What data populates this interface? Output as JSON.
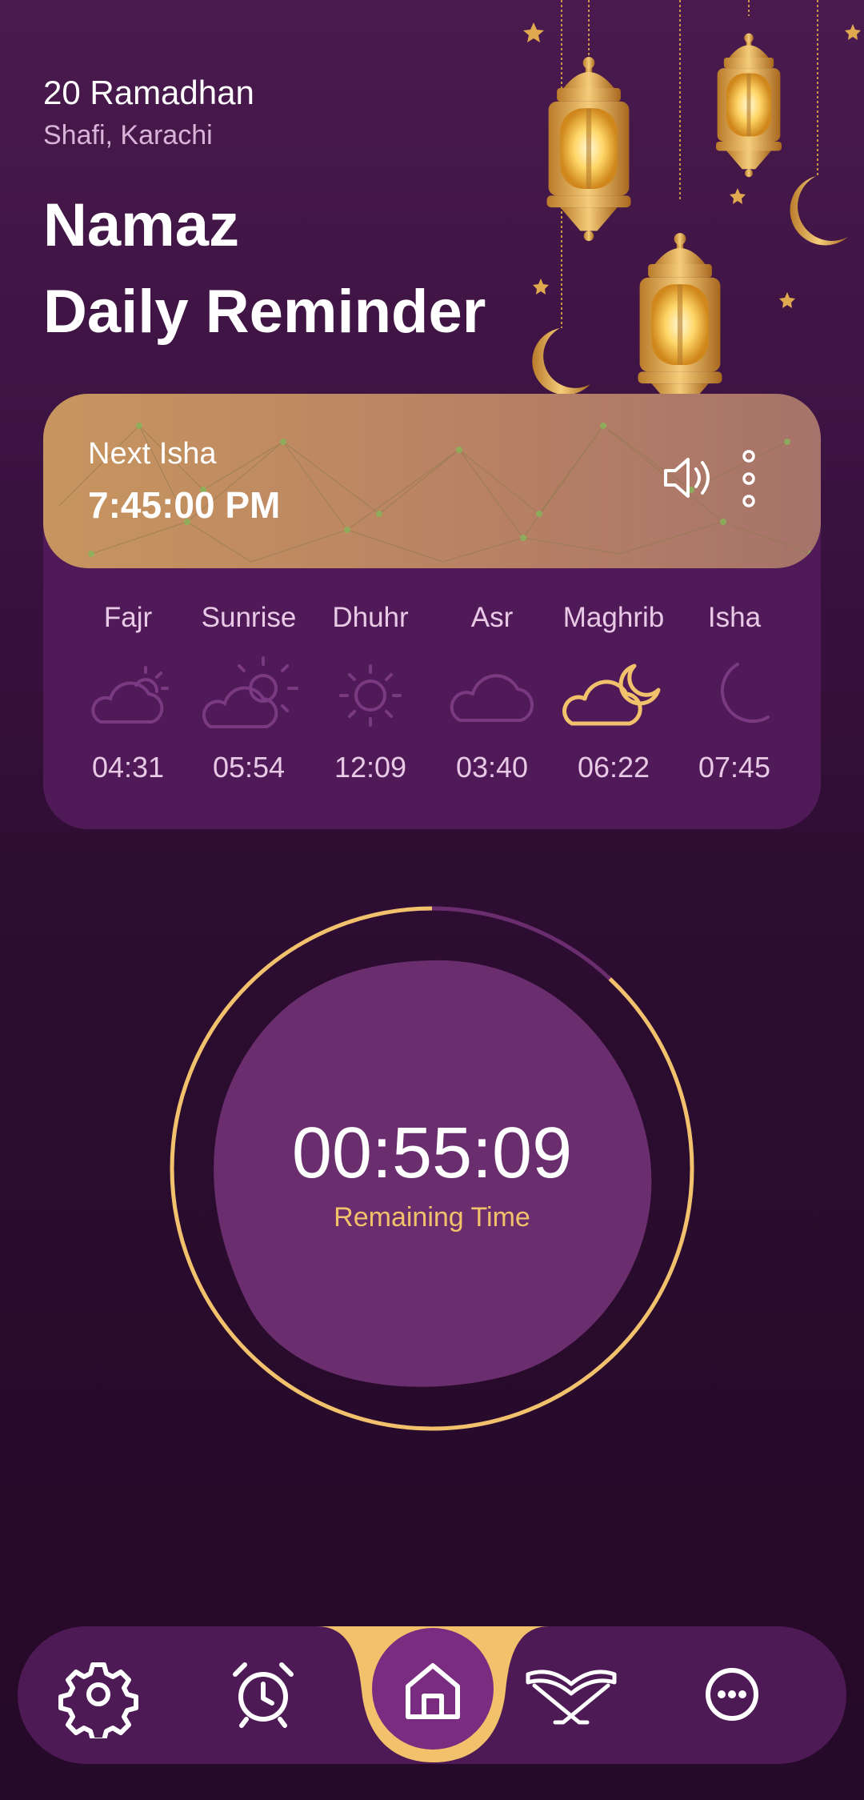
{
  "header": {
    "hijri_date": "20 Ramadhan",
    "location": "Shafi, Karachi",
    "title_line1": "Namaz",
    "title_line2": "Daily Reminder"
  },
  "next_prayer": {
    "label": "Next Isha",
    "time": "7:45:00 PM",
    "icons": [
      "speaker-icon",
      "more-vertical-icon"
    ]
  },
  "prayers": [
    {
      "name": "Fajr",
      "time": "04:31",
      "icon": "cloud-sun-small-icon",
      "active": false
    },
    {
      "name": "Sunrise",
      "time": "05:54",
      "icon": "sun-cloud-icon",
      "active": false
    },
    {
      "name": "Dhuhr",
      "time": "12:09",
      "icon": "sun-icon",
      "active": false
    },
    {
      "name": "Asr",
      "time": "03:40",
      "icon": "cloud-icon",
      "active": false
    },
    {
      "name": "Maghrib",
      "time": "06:22",
      "icon": "cloud-moon-icon",
      "active": true
    },
    {
      "name": "Isha",
      "time": "07:45",
      "icon": "crescent-moon-icon",
      "active": false
    }
  ],
  "countdown": {
    "value": "00:55:09",
    "label": "Remaining Time",
    "progress": 0.88
  },
  "bottom_nav": [
    {
      "name": "settings",
      "icon": "gear-icon"
    },
    {
      "name": "alarm",
      "icon": "alarm-clock-icon"
    },
    {
      "name": "home",
      "icon": "home-icon",
      "active": true
    },
    {
      "name": "quran",
      "icon": "quran-stand-icon"
    },
    {
      "name": "more",
      "icon": "more-horizontal-icon"
    }
  ],
  "colors": {
    "background": "#2b0c2f",
    "card": "#501a58",
    "accent_gold": "#f1c26b",
    "inactive_icon": "#7a3a82",
    "blob": "#6a2d6d"
  }
}
